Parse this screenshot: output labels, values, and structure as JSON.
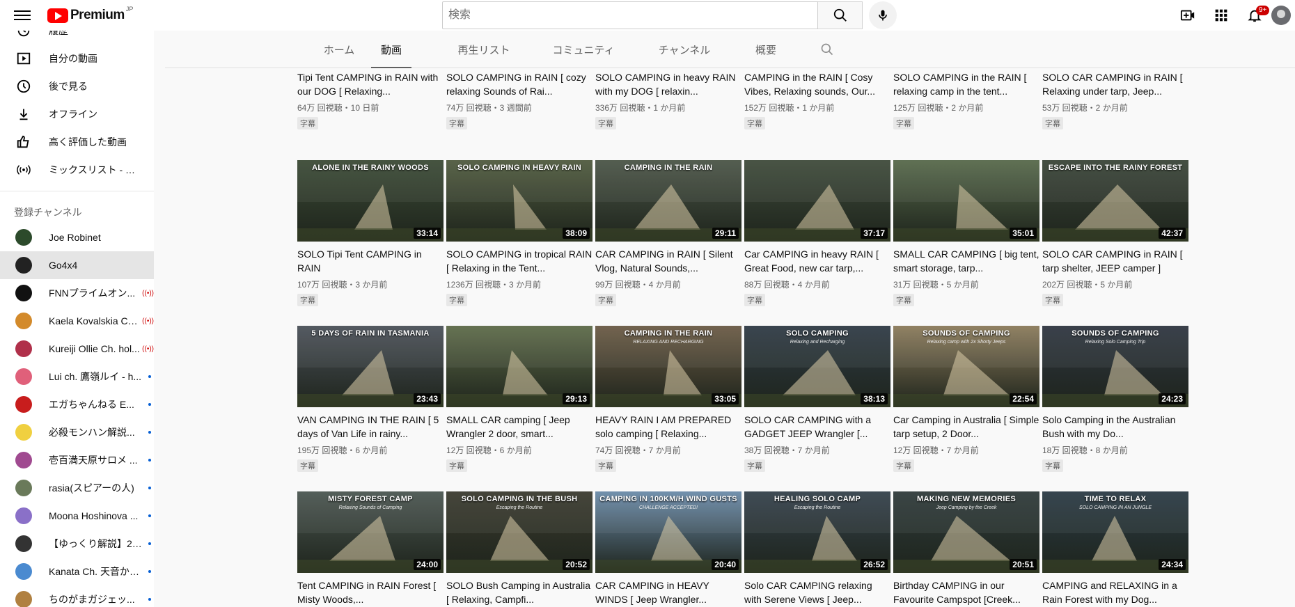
{
  "header": {
    "logo_text": "Premium",
    "region": "JP",
    "search_placeholder": "検索",
    "notification_count": "9+",
    "icons": [
      "menu-icon",
      "search-icon",
      "mic-icon",
      "create-icon",
      "apps-icon",
      "bell-icon"
    ]
  },
  "sidebar": {
    "items": [
      {
        "label": "履歴",
        "icon": "history-icon"
      },
      {
        "label": "自分の動画",
        "icon": "play-box-icon"
      },
      {
        "label": "後で見る",
        "icon": "clock-icon"
      },
      {
        "label": "オフライン",
        "icon": "download-icon"
      },
      {
        "label": "高く評価した動画",
        "icon": "thumb-up-icon"
      },
      {
        "label": "ミックスリスト - チ...",
        "icon": "mix-icon"
      }
    ],
    "subscriptions_heading": "登録チャンネル",
    "channels": [
      {
        "label": "Joe Robinet",
        "status": "none",
        "color": "#2c4a2b"
      },
      {
        "label": "Go4x4",
        "status": "none",
        "color": "#222222",
        "active": true
      },
      {
        "label": "FNNプライムオン...",
        "status": "live",
        "color": "#111111"
      },
      {
        "label": "Kaela Kovalskia Ch...",
        "status": "live",
        "color": "#d38a2b"
      },
      {
        "label": "Kureiji Ollie Ch. hol...",
        "status": "live",
        "color": "#b0304a"
      },
      {
        "label": "Lui ch. 鷹嶺ルイ - h...",
        "status": "new",
        "color": "#e0607a"
      },
      {
        "label": "エガちゃんねる E...",
        "status": "new",
        "color": "#c81d1d"
      },
      {
        "label": "必殺モンハン解説...",
        "status": "new",
        "color": "#f0d040"
      },
      {
        "label": "壱百満天原サロメ ...",
        "status": "new",
        "color": "#a04a90"
      },
      {
        "label": "rasia(スピアーの人)",
        "status": "new",
        "color": "#6a7a5a"
      },
      {
        "label": "Moona Hoshinova ...",
        "status": "new",
        "color": "#8a70c8"
      },
      {
        "label": "【ゆっくり解説】2c...",
        "status": "new",
        "color": "#333333"
      },
      {
        "label": "Kanata Ch. 天音かな...",
        "status": "new",
        "color": "#4a8ad0"
      },
      {
        "label": "ちのがまガジェッ...",
        "status": "new",
        "color": "#b08040"
      }
    ]
  },
  "tabs": [
    "ホーム",
    "動画",
    "再生リスト",
    "コミュニティ",
    "チャンネル",
    "概要"
  ],
  "active_tab": "動画",
  "videos": [
    {
      "title": "Tipi Tent CAMPING in RAIN with our DOG [ Relaxing...",
      "meta": "64万 回視聴・10 日前",
      "badge": "字幕",
      "duration": "",
      "caption": "",
      "sub": "",
      "tone": "#5a4a3a"
    },
    {
      "title": "SOLO CAMPING in RAIN [ cozy relaxing Sounds of Rai...",
      "meta": "74万 回視聴・3 週間前",
      "badge": "字幕",
      "duration": "",
      "caption": "",
      "sub": "",
      "tone": "#4a3a2a"
    },
    {
      "title": "SOLO CAMPING in heavy RAIN with my DOG [ relaxin...",
      "meta": "336万 回視聴・1 か月前",
      "badge": "字幕",
      "duration": "",
      "caption": "",
      "sub": "",
      "tone": "#6a4a2a"
    },
    {
      "title": "CAMPING in the RAIN [ Cosy Vibes, Relaxing sounds, Our...",
      "meta": "152万 回視聴・1 か月前",
      "badge": "字幕",
      "duration": "",
      "caption": "",
      "sub": "",
      "tone": "#5a3a1a"
    },
    {
      "title": "SOLO CAMPING in the RAIN [ relaxing camp in the tent...",
      "meta": "125万 回視聴・2 か月前",
      "badge": "字幕",
      "duration": "",
      "caption": "",
      "sub": "",
      "tone": "#4a3a2a"
    },
    {
      "title": "SOLO CAR CAMPING in RAIN [ Relaxing under tarp, Jeep...",
      "meta": "53万 回視聴・2 か月前",
      "badge": "字幕",
      "duration": "",
      "caption": "",
      "sub": "",
      "tone": "#3a4a3a"
    },
    {
      "title": "SOLO Tipi Tent CAMPING in RAIN",
      "meta": "107万 回視聴・3 か月前",
      "badge": "字幕",
      "duration": "33:14",
      "caption": "ALONE IN THE RAINY WOODS",
      "sub": "",
      "tone": "#3b4a35"
    },
    {
      "title": "SOLO CAMPING in tropical RAIN [ Relaxing in the Tent...",
      "meta": "1236万 回視聴・3 か月前",
      "badge": "字幕",
      "duration": "38:09",
      "caption": "SOLO CAMPING IN HEAVY RAIN",
      "sub": "",
      "tone": "#4f5a3e"
    },
    {
      "title": "CAR CAMPING in RAIN [ Silent Vlog, Natural Sounds,...",
      "meta": "99万 回視聴・4 か月前",
      "badge": "字幕",
      "duration": "29:11",
      "caption": "CAMPING IN THE RAIN",
      "sub": "",
      "tone": "#4a5446"
    },
    {
      "title": "Car CAMPING in heavy RAIN [ Great Food, new car tarp,...",
      "meta": "88万 回視聴・4 か月前",
      "badge": "字幕",
      "duration": "37:17",
      "caption": "",
      "sub": "",
      "tone": "#3e4a3a"
    },
    {
      "title": "SMALL CAR CAMPING [ big tent, smart storage, tarp...",
      "meta": "31万 回視聴・5 か月前",
      "badge": "字幕",
      "duration": "35:01",
      "caption": "",
      "sub": "",
      "tone": "#56684a"
    },
    {
      "title": "SOLO CAR CAMPING in RAIN [ tarp shelter, JEEP camper ]",
      "meta": "202万 回視聴・5 か月前",
      "badge": "字幕",
      "duration": "42:37",
      "caption": "ESCAPE INTO THE RAINY FOREST",
      "sub": "",
      "tone": "#3a4438"
    },
    {
      "title": "VAN CAMPING IN THE RAIN [ 5 days of Van Life in rainy...",
      "meta": "195万 回視聴・6 か月前",
      "badge": "字幕",
      "duration": "23:43",
      "caption": "5 DAYS OF RAIN IN TASMANIA",
      "sub": "",
      "tone": "#4a5058"
    },
    {
      "title": "SMALL CAR camping [ Jeep Wrangler 2 door, smart...",
      "meta": "12万 回視聴・6 か月前",
      "badge": "字幕",
      "duration": "29:13",
      "caption": "",
      "sub": "",
      "tone": "#5d6a48"
    },
    {
      "title": "HEAVY RAIN I AM PREPARED solo camping [ Relaxing...",
      "meta": "74万 回視聴・7 か月前",
      "badge": "字幕",
      "duration": "33:05",
      "caption": "CAMPING IN THE RAIN",
      "sub": "RELAXING AND RECHARGING",
      "tone": "#6a5a44"
    },
    {
      "title": "SOLO CAR CAMPING with a GADGET JEEP Wrangler [...",
      "meta": "38万 回視聴・7 か月前",
      "badge": "字幕",
      "duration": "38:13",
      "caption": "SOLO CAMPING",
      "sub": "Relaxing and Recharging",
      "tone": "#2e3a44"
    },
    {
      "title": "Car Camping in Australia [ Simple tarp setup, 2 Door...",
      "meta": "12万 回視聴・7 か月前",
      "badge": "字幕",
      "duration": "22:54",
      "caption": "SOUNDS OF CAMPING",
      "sub": "Relaxing camp with 2x Shorty Jeeps",
      "tone": "#8a7a5a"
    },
    {
      "title": "Solo Camping in the Australian Bush with my Do...",
      "meta": "18万 回視聴・8 か月前",
      "badge": "字幕",
      "duration": "24:23",
      "caption": "SOUNDS OF CAMPING",
      "sub": "Relaxing Solo Camping Trip",
      "tone": "#2e3540"
    },
    {
      "title": "Tent CAMPING in RAIN Forest [ Misty Woods,...",
      "meta": "",
      "badge": "",
      "duration": "24:00",
      "caption": "MISTY FOREST CAMP",
      "sub": "Relaxing Sounds of Camping",
      "tone": "#4a5550"
    },
    {
      "title": "SOLO Bush Camping in Australia [ Relaxing, Campfi...",
      "meta": "",
      "badge": "",
      "duration": "20:52",
      "caption": "SOLO CAMPING IN THE BUSH",
      "sub": "Escaping the Routine",
      "tone": "#3a3a2e"
    },
    {
      "title": "CAR CAMPING in HEAVY WINDS [ Jeep Wrangler...",
      "meta": "",
      "badge": "",
      "duration": "20:40",
      "caption": "CAMPING IN 100KM/H WIND GUSTS",
      "sub": "CHALLENGE ACCEPTED!",
      "tone": "#6a8aa8"
    },
    {
      "title": "Solo CAR CAMPING relaxing with Serene Views [ Jeep...",
      "meta": "",
      "badge": "",
      "duration": "26:52",
      "caption": "HEALING SOLO CAMP",
      "sub": "Escaping the Routine",
      "tone": "#33404a"
    },
    {
      "title": "Birthday CAMPING in our Favourite Campspot [Creek...",
      "meta": "",
      "badge": "",
      "duration": "20:51",
      "caption": "MAKING NEW MEMORIES",
      "sub": "Jeep Camping by the Creek",
      "tone": "#2e3a3a"
    },
    {
      "title": "CAMPING and RELAXING in a Rain Forest with my Dog...",
      "meta": "",
      "badge": "",
      "duration": "24:34",
      "caption": "TIME TO RELAX",
      "sub": "SOLO CAMPING IN AN JUNGLE",
      "tone": "#2a3a44"
    }
  ]
}
